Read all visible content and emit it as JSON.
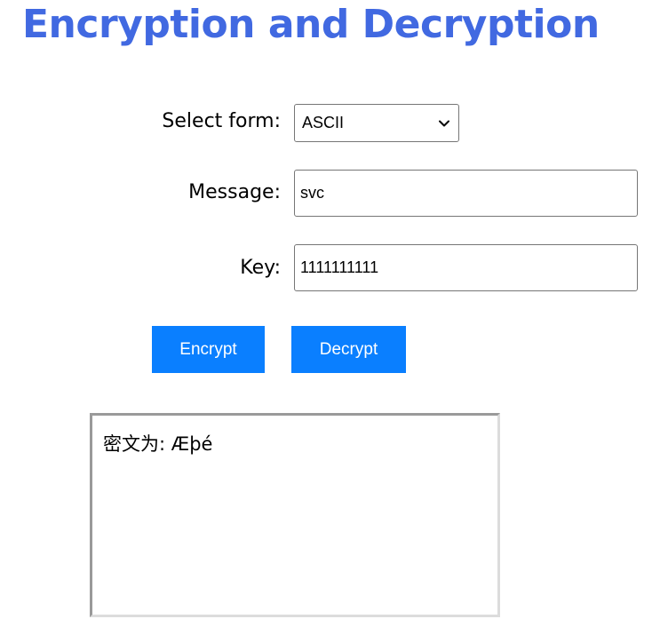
{
  "page": {
    "title": "Encryption and Decryption"
  },
  "form": {
    "select_label": "Select form:",
    "select_value": "ASCII",
    "message_label": "Message:",
    "message_value": "svc",
    "key_label": "Key:",
    "key_value": "1111111111"
  },
  "buttons": {
    "encrypt": "Encrypt",
    "decrypt": "Decrypt"
  },
  "output": {
    "text": "密文为: Æþé"
  },
  "colors": {
    "title": "#4169e1",
    "button_bg": "#0a7fff",
    "button_text": "#ffffff"
  }
}
